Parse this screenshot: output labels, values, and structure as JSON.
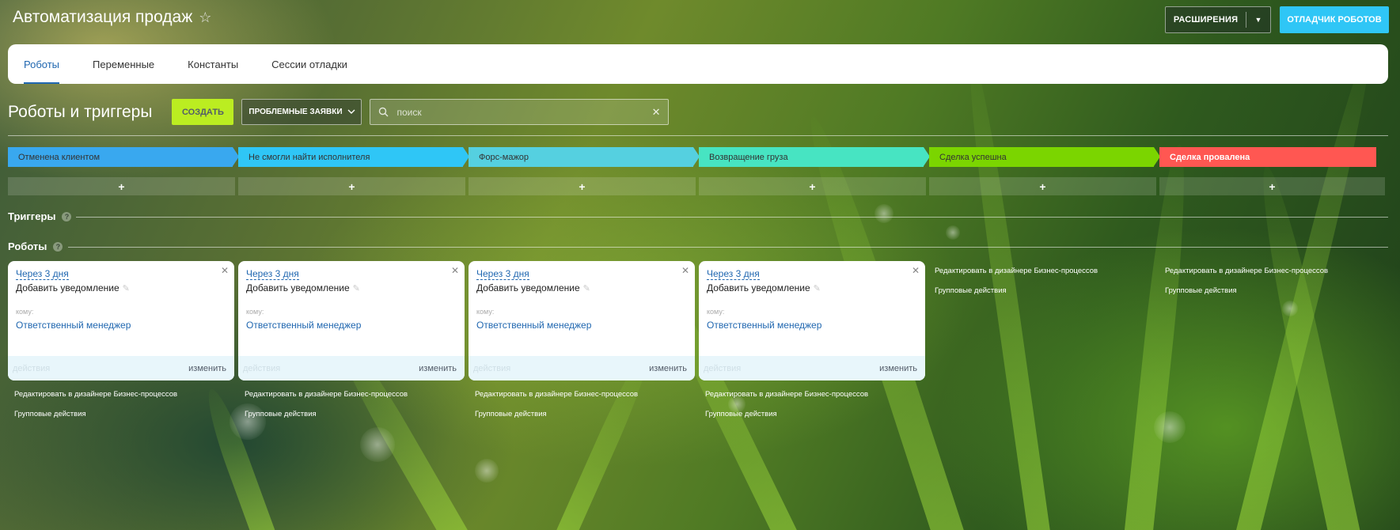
{
  "app": {
    "title": "Автоматизация продаж",
    "star_icon": "star-icon"
  },
  "header_buttons": {
    "extensions": "РАСШИРЕНИЯ",
    "debugger": "ОТЛАДЧИК РОБОТОВ"
  },
  "tabs": [
    {
      "label": "Роботы",
      "active": true
    },
    {
      "label": "Переменные",
      "active": false
    },
    {
      "label": "Константы",
      "active": false
    },
    {
      "label": "Сессии отладки",
      "active": false
    }
  ],
  "toolbar": {
    "title": "Роботы и триггеры",
    "create": "СОЗДАТЬ",
    "problem": "ПРОБЛЕМНЫЕ ЗАЯВКИ",
    "search_placeholder": "поиск"
  },
  "stages": [
    {
      "label": "Отменена клиентом",
      "color": "#39a8ef"
    },
    {
      "label": "Не смогли найти исполнителя",
      "color": "#2fc6f6"
    },
    {
      "label": "Форс-мажор",
      "color": "#55d0e0"
    },
    {
      "label": "Возвращение груза",
      "color": "#47e4c2"
    },
    {
      "label": "Сделка успешна",
      "color": "#7bd500"
    },
    {
      "label": "Сделка провалена",
      "color": "#ff5752"
    }
  ],
  "plus_label": "+",
  "sections": {
    "triggers": "Триггеры",
    "robots": "Роботы",
    "help": "?"
  },
  "robots": [
    {
      "delay": "Через 3 дня",
      "title": "Добавить уведомление",
      "to_label": "кому:",
      "to_value": "Ответственный менеджер",
      "actions": "действия",
      "edit": "изменить"
    },
    {
      "delay": "Через 3 дня",
      "title": "Добавить уведомление",
      "to_label": "кому:",
      "to_value": "Ответственный менеджер",
      "actions": "действия",
      "edit": "изменить"
    },
    {
      "delay": "Через 3 дня",
      "title": "Добавить уведомление",
      "to_label": "кому:",
      "to_value": "Ответственный менеджер",
      "actions": "действия",
      "edit": "изменить"
    },
    {
      "delay": "Через 3 дня",
      "title": "Добавить уведомление",
      "to_label": "кому:",
      "to_value": "Ответственный менеджер",
      "actions": "действия",
      "edit": "изменить"
    }
  ],
  "links": {
    "designer": "Редактировать в дизайнере Бизнес-процессов",
    "group": "Групповые действия"
  }
}
